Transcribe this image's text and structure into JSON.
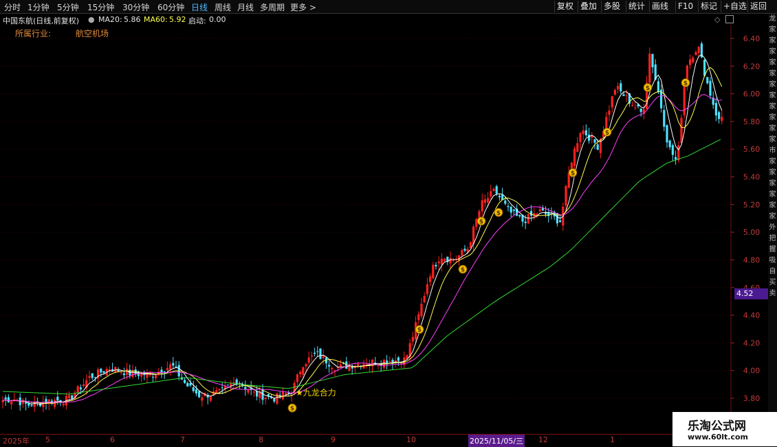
{
  "toolbar": {
    "periods": [
      "分时",
      "1分钟",
      "5分钟",
      "15分钟",
      "30分钟",
      "60分钟",
      "日线",
      "周线",
      "月线",
      "多周期",
      "更多 >"
    ],
    "active_period": "日线",
    "actions": [
      "复权",
      "叠加",
      "多股",
      "统计",
      "画线",
      "F10",
      "标记",
      "+自选",
      "返回"
    ]
  },
  "info": {
    "stock": "中国东航(日线,前复权)",
    "ma20_label": "MA20:",
    "ma20_value": "5.86",
    "ma60_label": "MA60:",
    "ma60_value": "5.92",
    "start_label": "启动:",
    "start_value": "0.00",
    "industry_label": "所属行业:",
    "industry_value": "航空机场"
  },
  "chart_data": {
    "type": "candlestick",
    "ylim": [
      3.7,
      6.5
    ],
    "ytick_labels": [
      "3.80",
      "4.00",
      "4.20",
      "4.40",
      "4.60",
      "4.80",
      "5.00",
      "5.20",
      "5.40",
      "5.60",
      "5.80",
      "6.00",
      "6.20",
      "6.40"
    ],
    "current_price_tag": "4.52",
    "x_labels": [
      "2025年",
      "5",
      "6",
      "7",
      "8",
      "9",
      "10",
      "11",
      "12",
      "1"
    ],
    "highlight_date": "2025/11/05/三",
    "signal_label": "★九龙合力",
    "colors": {
      "up": "#ff2020",
      "down": "#4fe0ff",
      "ma_short": "#ffffff",
      "ma_mid": "#ffff55",
      "ma_long": "#ff40ff",
      "ma_60": "#33dd33"
    },
    "close_anchors": [
      [
        0,
        3.78
      ],
      [
        18,
        3.8
      ],
      [
        40,
        3.75
      ],
      [
        70,
        3.78
      ],
      [
        100,
        3.79
      ],
      [
        130,
        3.95
      ],
      [
        160,
        4.02
      ],
      [
        190,
        3.98
      ],
      [
        220,
        3.97
      ],
      [
        250,
        4.04
      ],
      [
        270,
        3.9
      ],
      [
        290,
        3.82
      ],
      [
        320,
        3.84
      ],
      [
        345,
        3.93
      ],
      [
        370,
        3.83
      ],
      [
        400,
        3.8
      ],
      [
        425,
        3.85
      ],
      [
        440,
        4.05
      ],
      [
        460,
        4.12
      ],
      [
        490,
        4.02
      ],
      [
        520,
        4.05
      ],
      [
        560,
        4.07
      ],
      [
        590,
        4.08
      ],
      [
        608,
        4.38
      ],
      [
        625,
        4.7
      ],
      [
        640,
        4.83
      ],
      [
        660,
        4.8
      ],
      [
        680,
        4.88
      ],
      [
        700,
        5.2
      ],
      [
        720,
        5.3
      ],
      [
        740,
        5.15
      ],
      [
        760,
        5.08
      ],
      [
        785,
        5.15
      ],
      [
        815,
        5.08
      ],
      [
        830,
        5.5
      ],
      [
        845,
        5.75
      ],
      [
        870,
        5.62
      ],
      [
        895,
        6.05
      ],
      [
        915,
        5.95
      ],
      [
        935,
        5.85
      ],
      [
        945,
        6.3
      ],
      [
        960,
        5.95
      ],
      [
        972,
        5.62
      ],
      [
        985,
        5.5
      ],
      [
        997,
        6.2
      ],
      [
        1015,
        6.35
      ],
      [
        1030,
        6.05
      ],
      [
        1045,
        5.8
      ],
      [
        1052,
        5.85
      ]
    ],
    "ma60_anchors": [
      [
        0,
        3.85
      ],
      [
        100,
        3.83
      ],
      [
        200,
        3.9
      ],
      [
        270,
        3.95
      ],
      [
        350,
        3.9
      ],
      [
        420,
        3.87
      ],
      [
        500,
        3.97
      ],
      [
        600,
        4.02
      ],
      [
        650,
        4.25
      ],
      [
        720,
        4.5
      ],
      [
        800,
        4.75
      ],
      [
        830,
        4.87
      ],
      [
        880,
        5.12
      ],
      [
        930,
        5.37
      ],
      [
        970,
        5.5
      ],
      [
        1000,
        5.55
      ],
      [
        1052,
        5.68
      ]
    ],
    "signal_x": [
      425,
      610,
      673,
      700,
      725,
      833,
      883,
      942,
      997
    ]
  },
  "right_panel": [
    "龙",
    "家",
    "家",
    "家",
    "家",
    "家",
    "家",
    "家",
    "家",
    "家",
    "家",
    "家",
    "市",
    "家",
    "家",
    "家",
    "家",
    "家",
    "家",
    "外",
    "把",
    "握",
    "吸",
    "自",
    "买",
    "卖"
  ],
  "watermark": {
    "line1": "乐淘公式网",
    "line2": "www.60lt.com"
  }
}
